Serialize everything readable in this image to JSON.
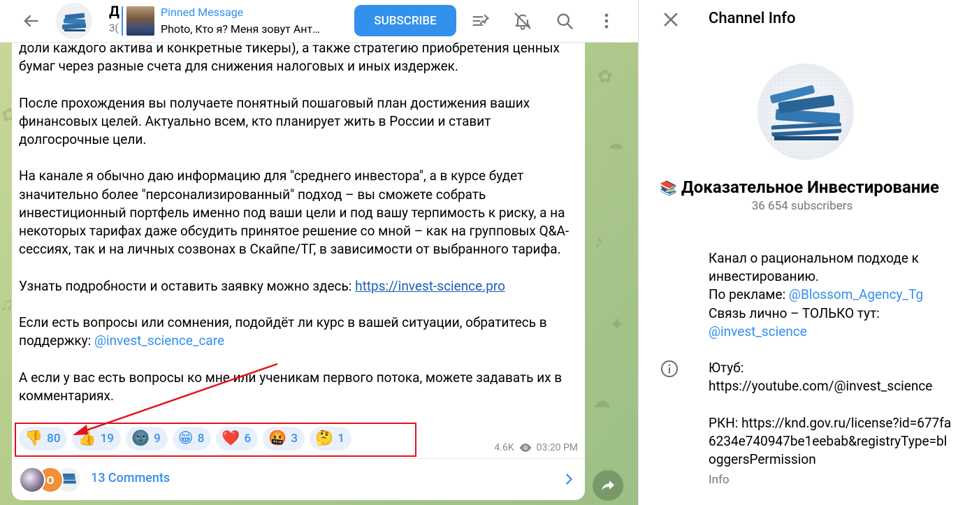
{
  "header": {
    "channel_title_fragment": "Д",
    "channel_sub_fragment": "3(",
    "pinned_label": "Pinned Message",
    "pinned_text": "Photo, Кто я? Меня зовут Ант…",
    "subscribe_label": "SUBSCRIBE"
  },
  "message": {
    "paragraphs": [
      "доли каждого актива и конкретные тикеры), а также стратегию приобретения ценных бумаг через разные счета для снижения налоговых и иных издержек.",
      "После прохождения вы получаете понятный пошаговый план достижения ваших финансовых целей. Актуально всем, кто планирует жить в России и ставит долгосрочные цели.",
      "На канале я обычно даю информацию для \"среднего инвестора\", а в курсе будет значительно более \"персонализированный\" подход – вы сможете собрать инвестиционный портфель именно под ваши цели и под вашу терпимость к риску, а на некоторых тарифах даже обсудить принятое решение со мной – как на групповых Q&A-сессиях, так и на личных созвонах в Скайпе/ТГ, в зависимости от выбранного тарифа."
    ],
    "details_text": "Узнать подробности и оставить заявку можно здесь: ",
    "details_link": "https://invest-science.pro",
    "support_text": "Если есть вопросы или сомнения, подойдёт ли курс в вашей ситуации, обратитесь в поддержку: ",
    "support_link": "@invest_science_care",
    "closing_text": "А если у вас есть вопросы ко мне или ученикам первого потока, можете задавать их в комментариях.",
    "reactions": [
      {
        "emoji": "👎",
        "count": "80"
      },
      {
        "emoji": "👍",
        "count": "19"
      },
      {
        "emoji": "🌚",
        "count": "9"
      },
      {
        "emoji": "😁",
        "count": "8"
      },
      {
        "emoji": "❤️",
        "count": "6"
      },
      {
        "emoji": "🤬",
        "count": "3"
      },
      {
        "emoji": "🤔",
        "count": "1"
      }
    ],
    "views": "4.6K",
    "time": "03:20 PM",
    "comments_label": "13 Comments",
    "commenter_initial": "O"
  },
  "sidebar": {
    "title": "Channel Info",
    "channel_emoji": "📚",
    "channel_name": "Доказательное Инвестирование",
    "subscribers": "36 654 subscribers",
    "desc_line1": "Канал о рациональном подходе к инвестированию.",
    "ads_prefix": "По рекламе: ",
    "ads_link": "@Blossom_Agency_Tg",
    "contact_prefix": "Связь лично – ТОЛЬКО тут: ",
    "contact_link": "@invest_science",
    "youtube_label": "Ютуб:",
    "youtube_url": "https://youtube.com/@invest_science",
    "rkn_label": "РКН: https://knd.gov.ru/license?id=677fa6234e740947be1eebab&registryType=bloggersPermission",
    "info_label": "Info"
  },
  "colors": {
    "accent": "#3390ec",
    "annotation_red": "#e0141e"
  }
}
